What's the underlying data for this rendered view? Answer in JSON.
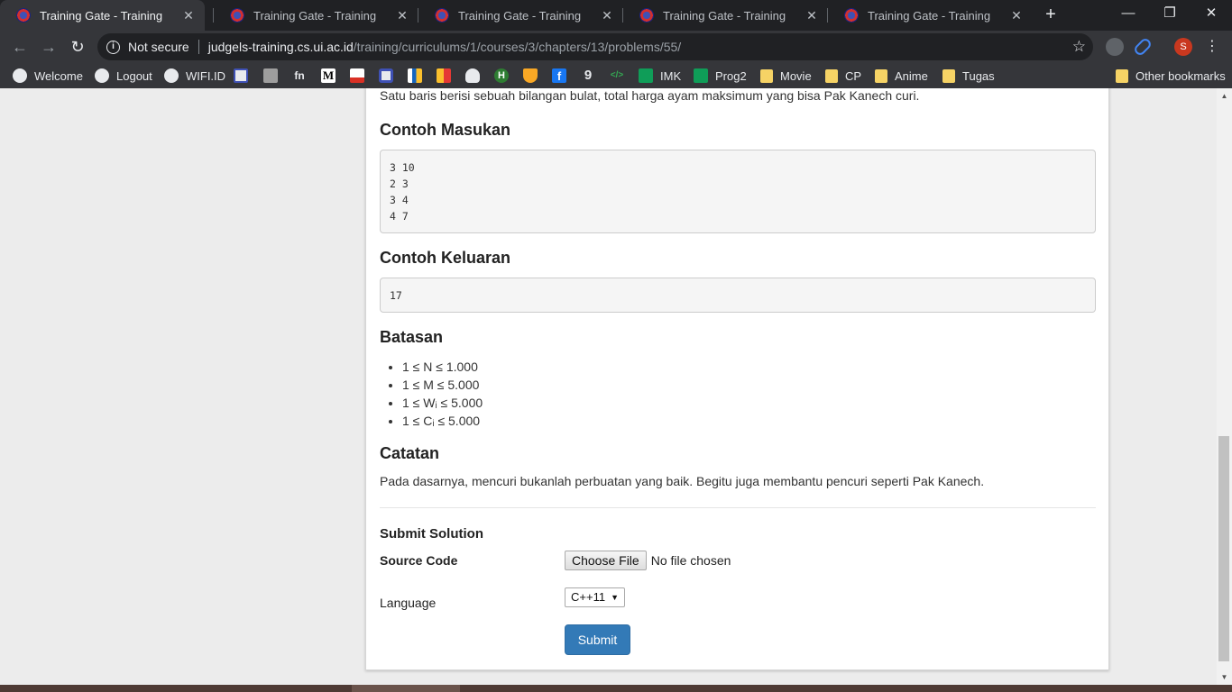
{
  "browser": {
    "tabs": [
      {
        "title": "Training Gate - Training",
        "active": true
      },
      {
        "title": "Training Gate - Training",
        "active": false
      },
      {
        "title": "Training Gate - Training",
        "active": false
      },
      {
        "title": "Training Gate - Training",
        "active": false
      },
      {
        "title": "Training Gate - Training",
        "active": false
      }
    ],
    "close_glyph": "✕",
    "new_tab_glyph": "+",
    "window_controls": {
      "minimize": "—",
      "maximize": "❐",
      "close": "✕"
    },
    "nav": {
      "back": "←",
      "forward": "→",
      "reload": "↻"
    },
    "security_label": "Not secure",
    "url_host": "judgels-training.cs.ui.ac.id",
    "url_path": "/training/curriculums/1/courses/3/chapters/13/problems/55/",
    "star_glyph": "☆",
    "avatar_letter": "S",
    "menu_glyph": "⋮",
    "bookmarks": [
      {
        "label": "Welcome",
        "icon": "globe-icon"
      },
      {
        "label": "Logout",
        "icon": "globe-icon"
      },
      {
        "label": "WIFI.ID",
        "icon": "globe-icon"
      },
      {
        "label": "IMK",
        "icon": "sheets-icon"
      },
      {
        "label": "Prog2",
        "icon": "sheets-icon"
      },
      {
        "label": "Movie",
        "icon": "folder-icon"
      },
      {
        "label": "CP",
        "icon": "folder-icon"
      },
      {
        "label": "Anime",
        "icon": "folder-icon"
      },
      {
        "label": "Tugas",
        "icon": "folder-icon"
      },
      {
        "label": "Other bookmarks",
        "icon": "folder-icon"
      }
    ],
    "bookmark_icon_glyphs": {
      "fn": "fn",
      "medium": "M",
      "h": "H",
      "g": "9",
      "code": "</>",
      "f": "f"
    },
    "colors": {
      "tab_strip": "#202124",
      "toolbar": "#35363a",
      "avatar": "#c9381f"
    }
  },
  "problem": {
    "cut_off_text": "Satu baris berisi sebuah bilangan bulat, total harga ayam maksimum yang bisa Pak Kanech curi.",
    "sample_input_heading": "Contoh Masukan",
    "sample_input": "3 10\n2 3\n3 4\n4 7",
    "sample_output_heading": "Contoh Keluaran",
    "sample_output": "17",
    "constraints_heading": "Batasan",
    "constraints": [
      "1 ≤ N ≤ 1.000",
      "1 ≤ M ≤ 5.000",
      "1 ≤ Wᵢ ≤ 5.000",
      "1 ≤ Cᵢ ≤ 5.000"
    ],
    "notes_heading": "Catatan",
    "notes": "Pada dasarnya, mencuri bukanlah perbuatan yang baik. Begitu juga membantu pencuri seperti Pak Kanech."
  },
  "submission": {
    "title": "Submit Solution",
    "source_label": "Source Code",
    "file_button": "Choose File",
    "file_status": "No file chosen",
    "language_label": "Language",
    "language_selected": "C++11",
    "select_arrow": "▼",
    "submit_label": "Submit",
    "colors": {
      "submit_bg": "#337ab7"
    }
  },
  "scrollbar": {
    "up_glyph": "▲",
    "down_glyph": "▼"
  }
}
